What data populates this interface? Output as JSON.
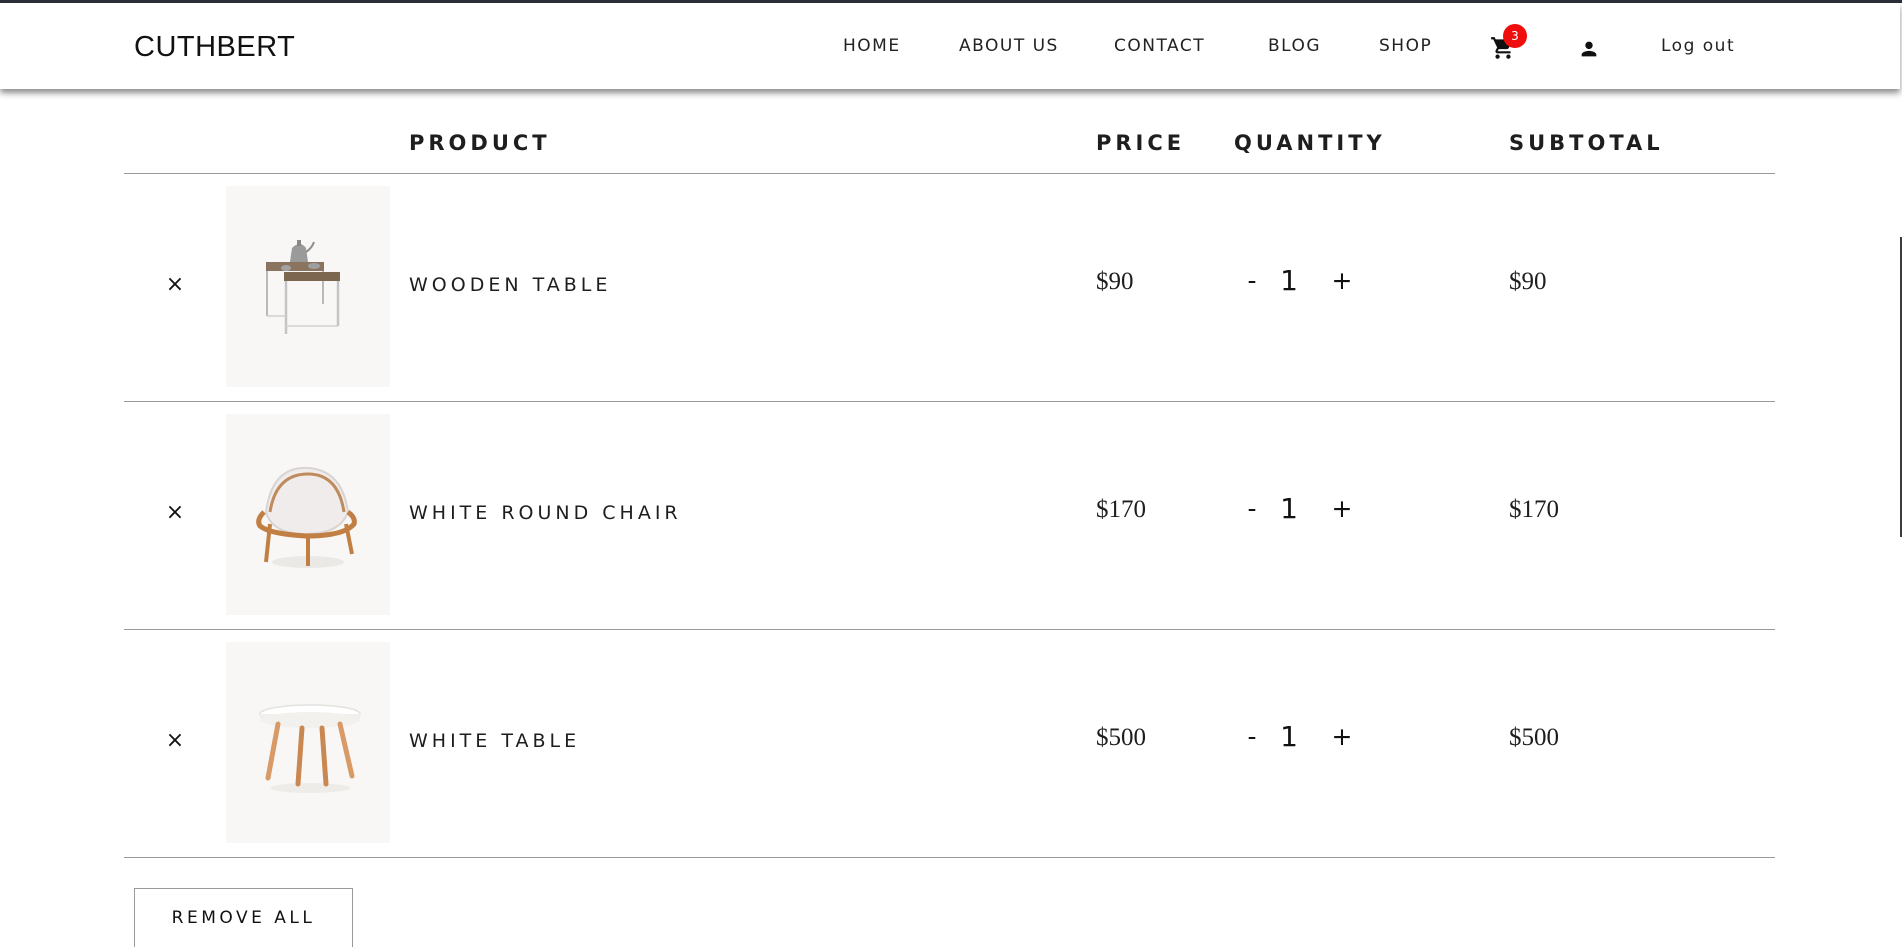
{
  "brand": "CUTHBERT",
  "nav": {
    "home": "HOME",
    "about": "ABOUT US",
    "contact": "CONTACT",
    "blog": "BLOG",
    "shop": "SHOP",
    "cart_count": "3",
    "logout": "Log out"
  },
  "icons": {
    "cart": "cart-icon",
    "user": "user-icon",
    "remove": "close-icon"
  },
  "colors": {
    "badge": "#f00d0d",
    "thumb_bg": "#f8f7f5",
    "divider": "#9a9a9a"
  },
  "cart": {
    "headers": {
      "product": "PRODUCT",
      "price": "PRICE",
      "quantity": "QUANTITY",
      "subtotal": "SUBTOTAL"
    },
    "items": [
      {
        "name": "WOODEN TABLE",
        "price": "$90",
        "quantity": "1",
        "subtotal": "$90",
        "remove": "×",
        "minus": "-",
        "plus": "+"
      },
      {
        "name": "WHITE ROUND CHAIR",
        "price": "$170",
        "quantity": "1",
        "subtotal": "$170",
        "remove": "×",
        "minus": "-",
        "plus": "+"
      },
      {
        "name": "WHITE TABLE",
        "price": "$500",
        "quantity": "1",
        "subtotal": "$500",
        "remove": "×",
        "minus": "-",
        "plus": "+"
      }
    ],
    "remove_all": "REMOVE ALL"
  }
}
